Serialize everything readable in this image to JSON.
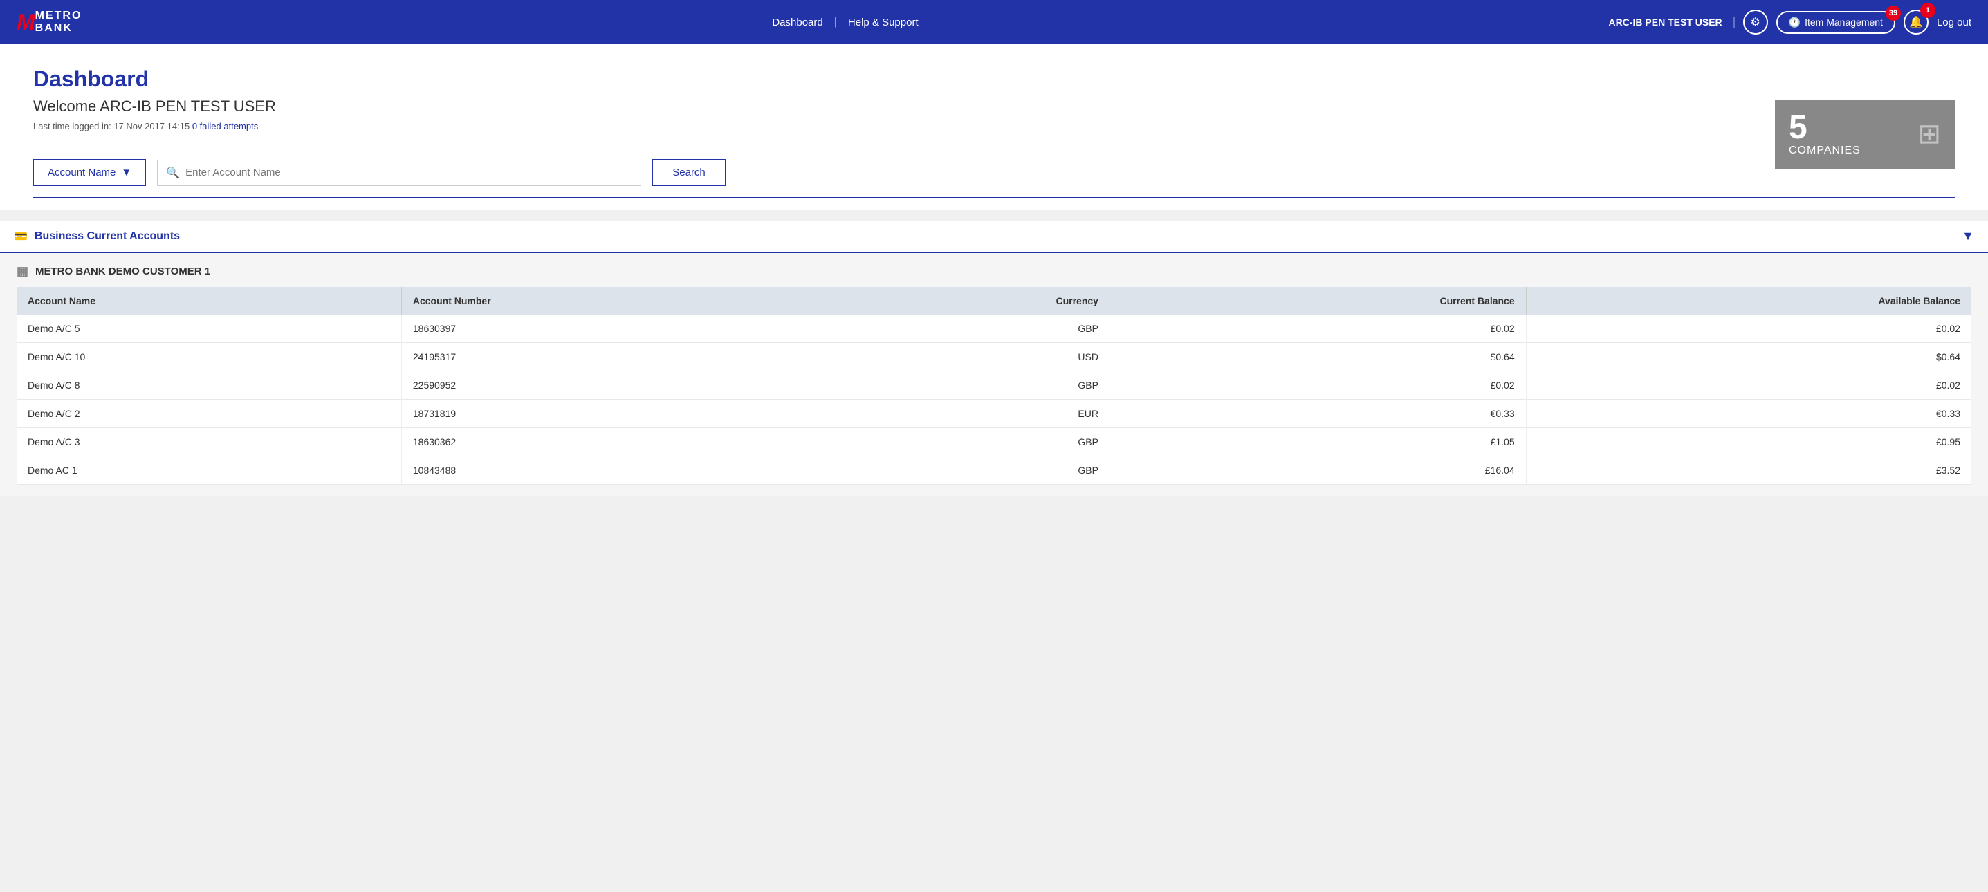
{
  "header": {
    "logo_m": "M",
    "logo_metro": "METRO",
    "logo_bank": "BANK",
    "nav_dashboard": "Dashboard",
    "nav_divider": "|",
    "nav_help": "Help & Support",
    "user_name": "ARC-IB PEN TEST USER",
    "item_management": "Item Management",
    "item_management_badge": "39",
    "bell_badge": "1",
    "logout": "Log out"
  },
  "dashboard": {
    "title": "Dashboard",
    "welcome": "Welcome ARC-IB PEN TEST USER",
    "last_login": "Last time logged in: 17 Nov 2017 14:15",
    "failed_attempts": "0 failed attempts"
  },
  "companies_widget": {
    "number": "5",
    "label": "COMPANIES"
  },
  "search": {
    "dropdown_label": "Account Name",
    "placeholder": "Enter Account Name",
    "button": "Search"
  },
  "business_accounts": {
    "section_label": "Business Current Accounts"
  },
  "company": {
    "name": "METRO BANK DEMO CUSTOMER 1",
    "table_headers": [
      "Account Name",
      "Account Number",
      "Currency",
      "Current Balance",
      "Available Balance"
    ],
    "rows": [
      {
        "account_name": "Demo A/C 5",
        "account_number": "18630397",
        "currency": "GBP",
        "current_balance": "£0.02",
        "available_balance": "£0.02"
      },
      {
        "account_name": "Demo A/C 10",
        "account_number": "24195317",
        "currency": "USD",
        "current_balance": "$0.64",
        "available_balance": "$0.64"
      },
      {
        "account_name": "Demo A/C 8",
        "account_number": "22590952",
        "currency": "GBP",
        "current_balance": "£0.02",
        "available_balance": "£0.02"
      },
      {
        "account_name": "Demo A/C 2",
        "account_number": "18731819",
        "currency": "EUR",
        "current_balance": "€0.33",
        "available_balance": "€0.33"
      },
      {
        "account_name": "Demo A/C 3",
        "account_number": "18630362",
        "currency": "GBP",
        "current_balance": "£1.05",
        "available_balance": "£0.95"
      },
      {
        "account_name": "Demo AC 1",
        "account_number": "10843488",
        "currency": "GBP",
        "current_balance": "£16.04",
        "available_balance": "£3.52"
      }
    ]
  }
}
